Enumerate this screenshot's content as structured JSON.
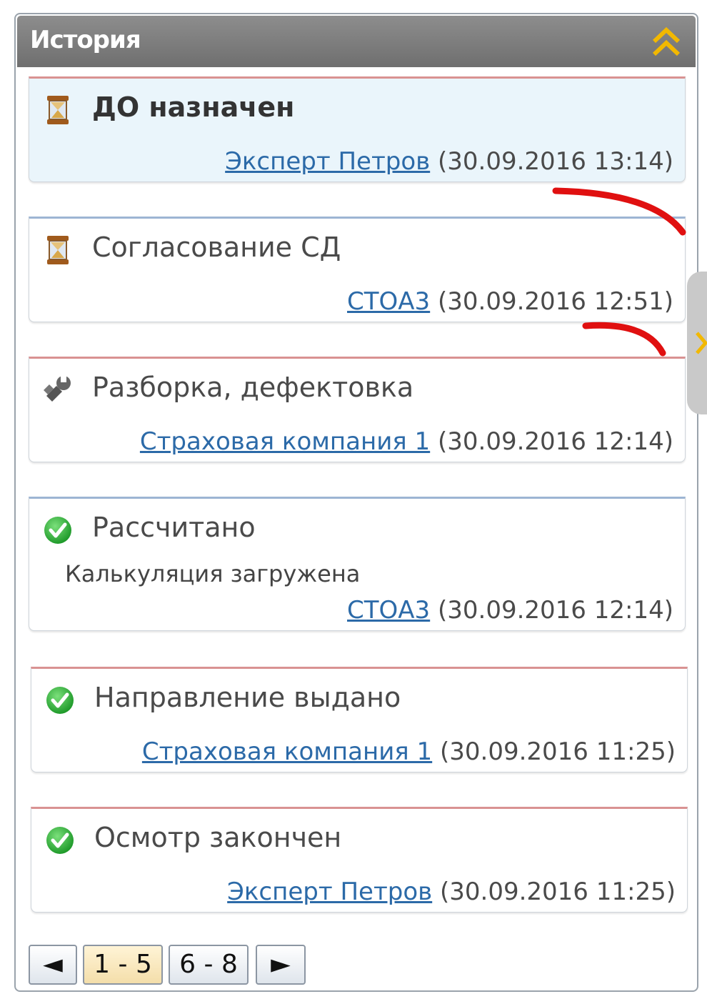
{
  "header": {
    "title": "История"
  },
  "history": [
    {
      "status": "ДО назначен",
      "icon": "hourglass-icon",
      "note": "",
      "actor": "Эксперт Петров",
      "datetime": "(30.09.2016 13:14)"
    },
    {
      "status": "Согласование СД",
      "icon": "hourglass-icon",
      "note": "",
      "actor": "СТОА3",
      "datetime": "(30.09.2016 12:51)"
    },
    {
      "status": "Разборка, дефектовка",
      "icon": "wrench-icon",
      "note": "",
      "actor": "Страховая компания 1",
      "datetime": "(30.09.2016 12:14)"
    },
    {
      "status": "Рассчитано",
      "icon": "check-icon",
      "note": "Калькуляция загружена",
      "actor": "СТОА3",
      "datetime": "(30.09.2016 12:14)"
    },
    {
      "status": "Направление выдано",
      "icon": "check-icon",
      "note": "",
      "actor": "Страховая компания 1",
      "datetime": "(30.09.2016 11:25)"
    },
    {
      "status": "Осмотр закончен",
      "icon": "check-icon",
      "note": "",
      "actor": "Эксперт Петров",
      "datetime": "(30.09.2016 11:25)"
    }
  ],
  "pager": {
    "prev": "◄",
    "pages": [
      "1 - 5",
      "6 - 8"
    ],
    "selected": "1 - 5",
    "next": "►"
  },
  "colors": {
    "header": "#7f7f7f",
    "collapse_icon": "#f2b800",
    "link": "#2c6aa8",
    "card_red_top": "#d99292",
    "card_blue_top": "#9db5d3",
    "active_card_bg": "#eaf5fb",
    "annotation_stroke": "#e01010"
  }
}
